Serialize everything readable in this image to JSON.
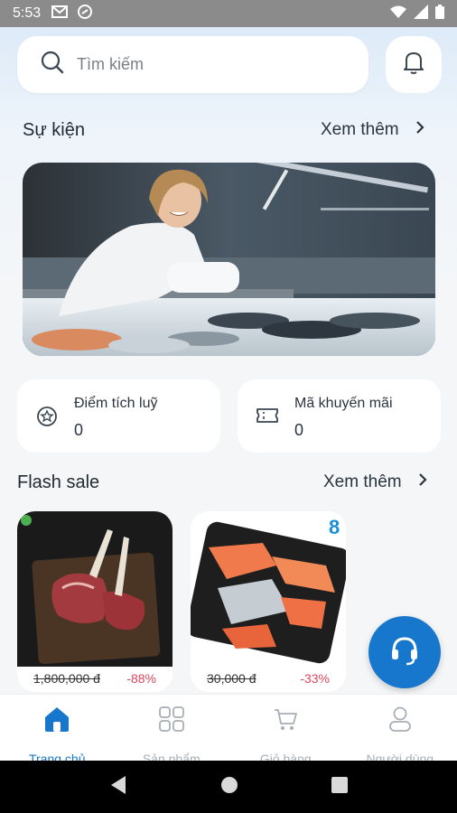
{
  "status_bar": {
    "time": "5:53"
  },
  "search": {
    "placeholder": "Tìm kiếm"
  },
  "events": {
    "title": "Sự kiện",
    "see_more": "Xem thêm"
  },
  "loyalty": {
    "points": {
      "label": "Điểm tích luỹ",
      "value": "0"
    },
    "promo": {
      "label": "Mã khuyến mãi",
      "value": "0"
    }
  },
  "flash_sale": {
    "title": "Flash sale",
    "see_more": "Xem thêm",
    "products": [
      {
        "old_price": "1,800,000 đ",
        "discount": "-88%"
      },
      {
        "old_price": "30,000 đ",
        "discount": "-33%"
      }
    ]
  },
  "bottom_nav": {
    "items": [
      {
        "label": "Trang chủ",
        "icon": "home-icon",
        "active": true
      },
      {
        "label": "Sản phẩm",
        "icon": "grid-icon",
        "active": false
      },
      {
        "label": "Giỏ hàng",
        "icon": "cart-icon",
        "active": false
      },
      {
        "label": "Người dùng",
        "icon": "user-icon",
        "active": false
      }
    ]
  },
  "colors": {
    "accent": "#1677cc",
    "discount": "#e0475d",
    "inactive": "#a7afb6"
  }
}
